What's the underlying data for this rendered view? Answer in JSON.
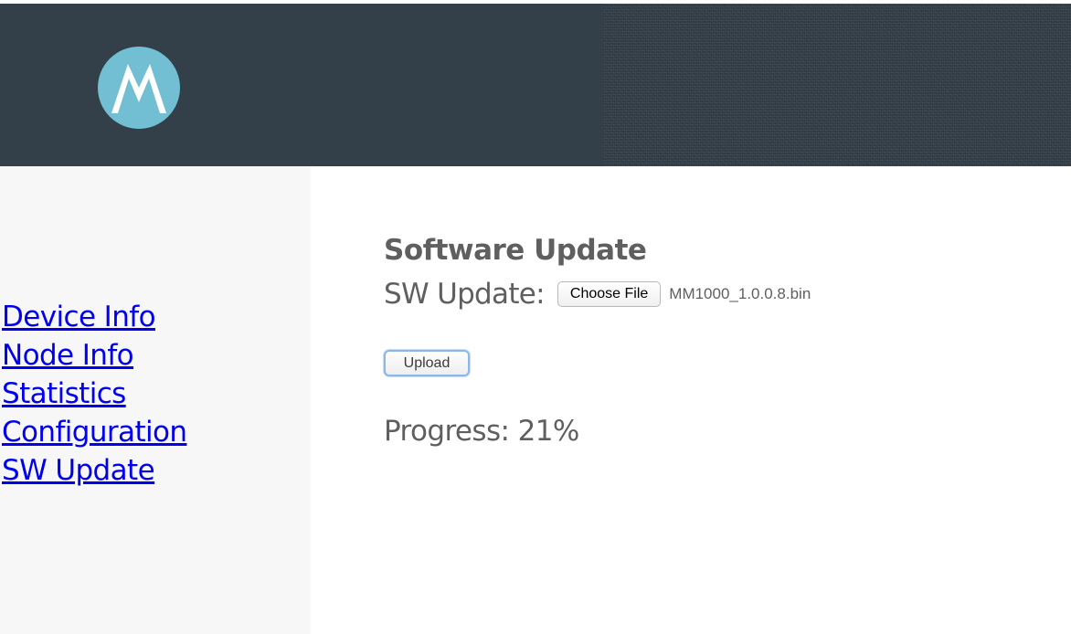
{
  "header": {
    "logo_icon": "motorola-logo-icon",
    "background_color": "#333f49",
    "logo_color": "#72bfd4"
  },
  "sidebar": {
    "links": [
      {
        "label": "Device Info"
      },
      {
        "label": "Node Info"
      },
      {
        "label": "Statistics"
      },
      {
        "label": "Configuration"
      },
      {
        "label": "SW Update"
      }
    ],
    "link_color": "#0000ee"
  },
  "main": {
    "title": "Software Update",
    "sw_update_label": "SW Update:",
    "choose_file_label": "Choose File",
    "file_name": "MM1000_1.0.0.8.bin",
    "upload_label": "Upload",
    "progress_text": "Progress: 21%",
    "progress_value": 21
  }
}
